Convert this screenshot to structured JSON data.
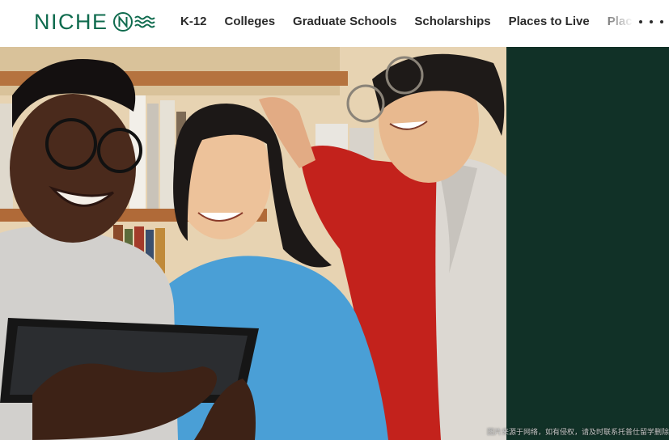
{
  "brand": {
    "name": "NICHE",
    "color": "#0f6b4e"
  },
  "nav": {
    "items": [
      {
        "label": "K-12"
      },
      {
        "label": "Colleges"
      },
      {
        "label": "Graduate Schools"
      },
      {
        "label": "Scholarships"
      },
      {
        "label": "Places to Live"
      },
      {
        "label": "Places to Work"
      }
    ],
    "more_icon": "ellipsis-icon"
  },
  "hero": {
    "photo_subject": "",
    "panel_color": "#113127"
  },
  "watermark": "图片来源于网络，如有侵权，请及时联系托普仕留学删除"
}
